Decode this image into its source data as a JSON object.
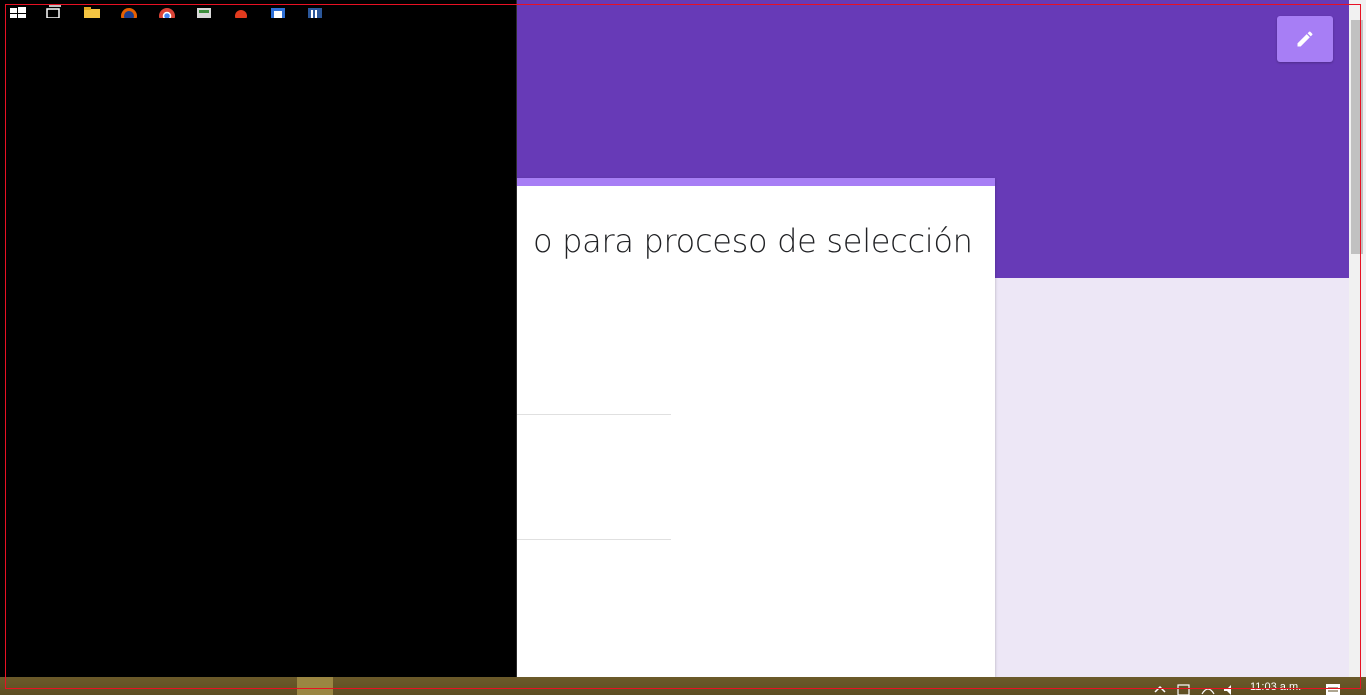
{
  "form": {
    "title": "o para proceso de selección"
  },
  "toolbar": {
    "edit_icon": "pencil-icon"
  },
  "taskbar": {
    "clock": "11:03 a.m.",
    "icons": [
      "windows-start-icon",
      "task-view-icon",
      "file-explorer-icon",
      "firefox-icon",
      "chrome-icon",
      "app-icon",
      "app-icon",
      "app-icon",
      "app-icon"
    ]
  },
  "colors": {
    "header": "#673ab7",
    "accent": "#a77ef5",
    "background": "#ede7f6",
    "taskbar": "#6b5a2a"
  }
}
